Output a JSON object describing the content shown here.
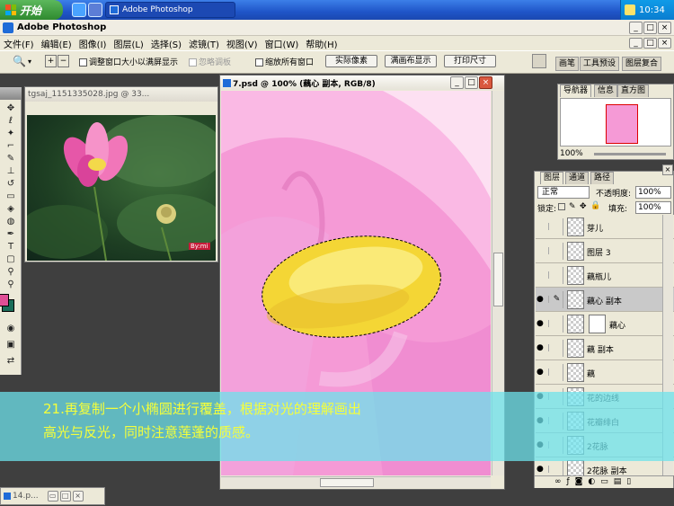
{
  "taskbar": {
    "start_label": "开始",
    "task_label": "Adobe Photoshop",
    "clock": "10:34"
  },
  "app": {
    "title": "Adobe Photoshop",
    "min": "_",
    "max": "□",
    "close": "×"
  },
  "menu": {
    "items": [
      "文件(F)",
      "编辑(E)",
      "图像(I)",
      "图层(L)",
      "选择(S)",
      "滤镜(T)",
      "视图(V)",
      "窗口(W)",
      "帮助(H)"
    ]
  },
  "options": {
    "resize_window": "调整窗口大小以满屏显示",
    "ignore_palettes": "忽略调板",
    "zoom_all": "缩放所有窗口",
    "actual_pixels": "实际像素",
    "fit_screen": "满画布显示",
    "print_size": "打印尺寸",
    "well_tabs": [
      "画笔",
      "工具预设",
      "图层复合"
    ]
  },
  "doc1": {
    "title": "tgsaj_1151335028.jpg @ 33...",
    "watermark": "By:mi"
  },
  "doc2": {
    "title": "7.psd @ 100% (藕心 副本, RGB/8)"
  },
  "navigator": {
    "tabs": [
      "导航器",
      "信息",
      "直方图"
    ],
    "zoom": "100%"
  },
  "layers": {
    "tabs": [
      "图层",
      "通道",
      "路径"
    ],
    "blend_mode": "正常",
    "opacity_label": "不透明度:",
    "opacity_value": "100%",
    "lock_label": "锁定:",
    "fill_label": "填充:",
    "fill_value": "100%",
    "rows": [
      {
        "name": "芽儿",
        "visible": false,
        "selected": false,
        "mask": false
      },
      {
        "name": "图层 3",
        "visible": false,
        "selected": false,
        "mask": false
      },
      {
        "name": "藕瓶儿",
        "visible": false,
        "selected": false,
        "mask": false
      },
      {
        "name": "藕心 副本",
        "visible": true,
        "selected": true,
        "mask": false
      },
      {
        "name": "藕心",
        "visible": true,
        "selected": false,
        "mask": true
      },
      {
        "name": "藕 副本",
        "visible": true,
        "selected": false,
        "mask": false
      },
      {
        "name": "藕",
        "visible": true,
        "selected": false,
        "mask": false
      },
      {
        "name": "花的边线",
        "visible": true,
        "selected": false,
        "mask": false
      },
      {
        "name": "花瓣绯白",
        "visible": true,
        "selected": false,
        "mask": false
      },
      {
        "name": "2花脉",
        "visible": true,
        "selected": false,
        "mask": false
      },
      {
        "name": "2花脉 副本",
        "visible": true,
        "selected": false,
        "mask": false
      }
    ]
  },
  "caption": {
    "line1": "21.再复制一个小椭圆进行覆盖，根据对光的理解画出",
    "line2": "高光与反光，同时注意莲蓬的质感。"
  },
  "doc3": {
    "title": "14.p..."
  },
  "colors": {
    "foreground": "#e04f96",
    "background": "#1a6e5a",
    "caption_text": "#f5ff3a",
    "canvas_pink": "#f59ad6"
  }
}
